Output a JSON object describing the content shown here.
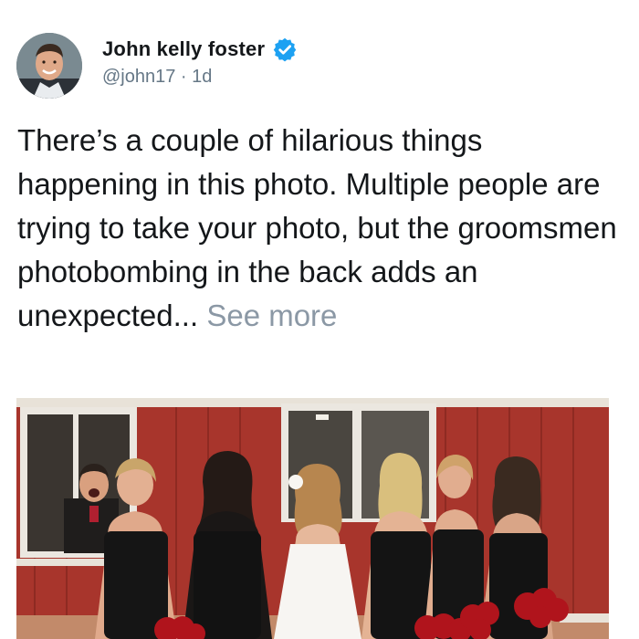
{
  "author": {
    "display_name": "John kelly foster",
    "handle": "@john17",
    "separator": " · ",
    "time": "1d",
    "verified_icon": "verified-badge-icon",
    "verified_color": "#1da1f2"
  },
  "tweet": {
    "text": "There’s a couple of hilarious things happening in this photo. Multiple people are trying to take your photo, but the groomsmen photobombing in the back adds an unexpected...",
    "see_more": "See more"
  },
  "photo": {
    "subject": "wedding party photo: bride and six bridesmaids in front of red barn, groomsman photobombing through window"
  },
  "colors": {
    "text": "#14171a",
    "muted": "#657786",
    "barn_red": "#a8352c"
  }
}
